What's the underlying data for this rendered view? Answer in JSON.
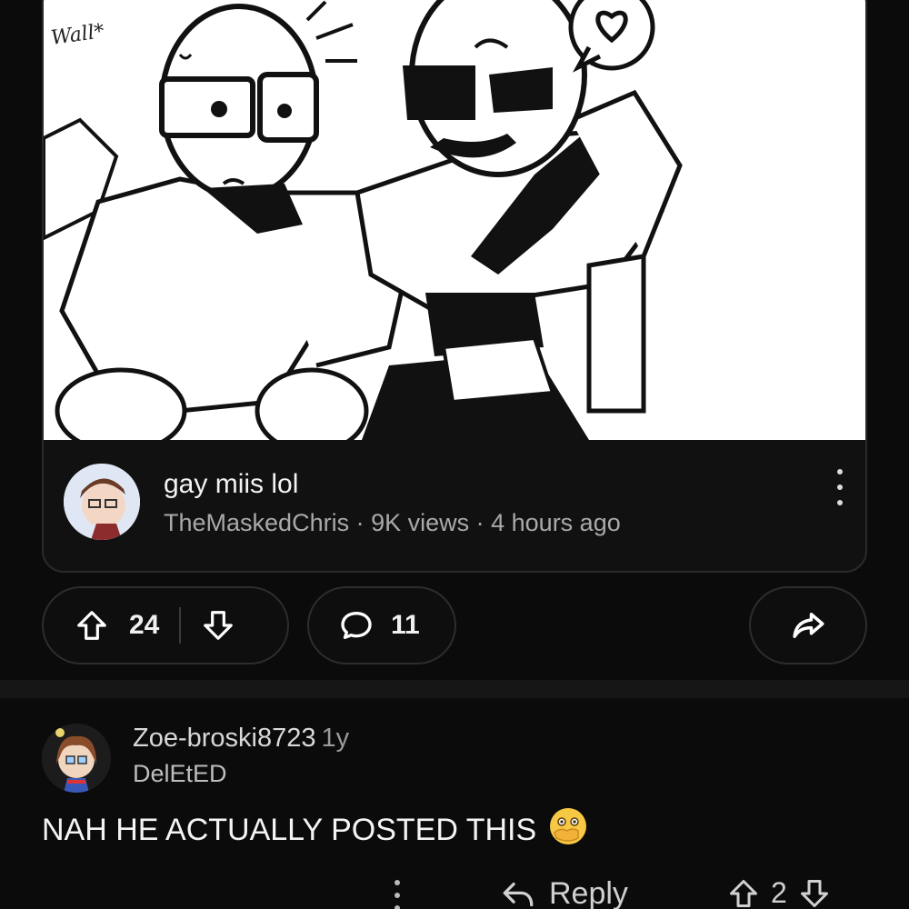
{
  "post": {
    "thumbnail_caption": "Wall*",
    "title": "gay miis lol",
    "channel": "TheMaskedChris",
    "separator": " · ",
    "views": "9K views",
    "time": "4 hours ago",
    "upvotes": "24",
    "comments": "11"
  },
  "comment": {
    "username": "Zoe-broski8723",
    "age": "1y",
    "flair": "DelEtED",
    "text": "NAH HE ACTUALLY POSTED THIS",
    "emoji": "face-with-open-eyes-and-hand-over-mouth",
    "reply_label": "Reply",
    "score": "2"
  },
  "colors": {
    "background": "#0b0b0b",
    "card": "#111111",
    "border": "#2a2a2a",
    "text_primary": "#f2f2f2",
    "text_secondary": "#a9a9a9"
  },
  "icons": [
    "upvote-icon",
    "downvote-icon",
    "comment-icon",
    "share-icon",
    "reply-icon",
    "more-options-icon"
  ]
}
